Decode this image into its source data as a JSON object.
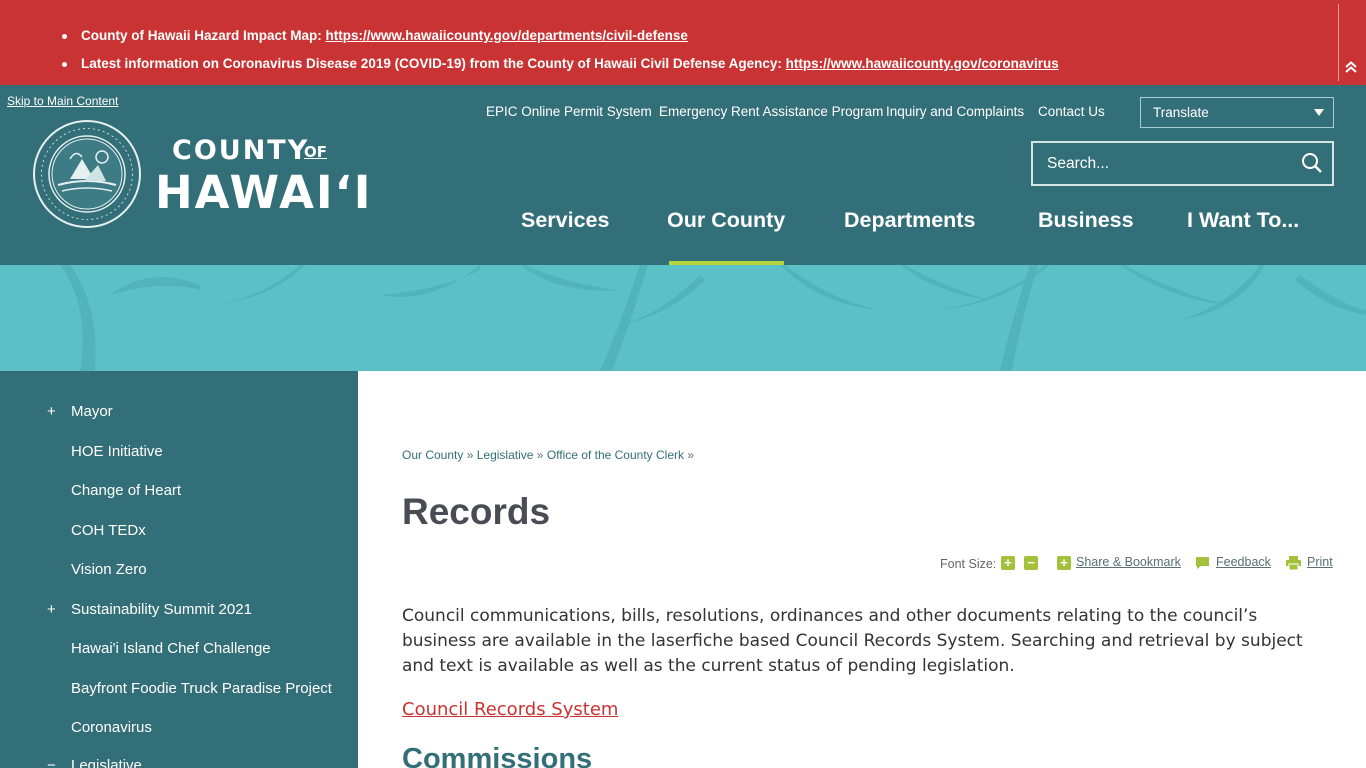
{
  "alert": {
    "items": [
      {
        "label": "County of Hawaii Hazard Impact Map:",
        "link": "https://www.hawaiicounty.gov/departments/civil-defense"
      },
      {
        "label": "Latest information on Coronavirus Disease 2019 (COVID-19) from the County of Hawaii Civil Defense Agency:",
        "link": "https://www.hawaiicounty.gov/coronavirus"
      }
    ],
    "collapse_icon": "chevron-double-up-icon"
  },
  "header": {
    "skip_link": "Skip to Main Content",
    "logo": {
      "county": "COUNTY",
      "of": "OF",
      "name": "HAWAIʻI"
    },
    "utility_links": [
      "EPIC Online Permit System",
      "Emergency Rent Assistance Program",
      "Inquiry and Complaints",
      "Contact Us"
    ],
    "translate": "Translate",
    "search_placeholder": "Search...",
    "main_nav": [
      "Services",
      "Our County",
      "Departments",
      "Business",
      "I Want To..."
    ],
    "active_nav": "Our County",
    "colors": {
      "header_bg": "#336f78",
      "alert_bg": "#c93333",
      "accent": "#b6d43e",
      "banner": "#5cc1c7"
    }
  },
  "sidebar": {
    "items": [
      {
        "label": "Mayor",
        "expandable": true,
        "marker": "+"
      },
      {
        "label": "HOE Initiative",
        "expandable": false
      },
      {
        "label": "Change of Heart",
        "expandable": false
      },
      {
        "label": "COH TEDx",
        "expandable": false
      },
      {
        "label": "Vision Zero",
        "expandable": false
      },
      {
        "label": "Sustainability Summit 2021",
        "expandable": true,
        "marker": "+"
      },
      {
        "label": "Hawai'i Island Chef Challenge",
        "expandable": false
      },
      {
        "label": "Bayfront Foodie Truck Paradise Project",
        "expandable": false
      },
      {
        "label": "Coronavirus",
        "expandable": false
      },
      {
        "label": "Legislative",
        "expandable": true,
        "marker": "−"
      }
    ]
  },
  "main": {
    "breadcrumb": [
      "Our County",
      "Legislative",
      "Office of the County Clerk"
    ],
    "breadcrumb_sep": "»",
    "title": "Records",
    "tools": {
      "font_size_label": "Font Size:",
      "increase": "+",
      "decrease": "−",
      "share": "Share & Bookmark",
      "feedback": "Feedback",
      "print": "Print"
    },
    "paragraph": "Council communications, bills, resolutions, ordinances and other documents relating to the council’s business are available in the laserfiche based Council Records System. Searching and retrieval by subject and text is available as well as the current status of pending legislation.",
    "link": "Council Records System",
    "subheading": "Commissions"
  }
}
